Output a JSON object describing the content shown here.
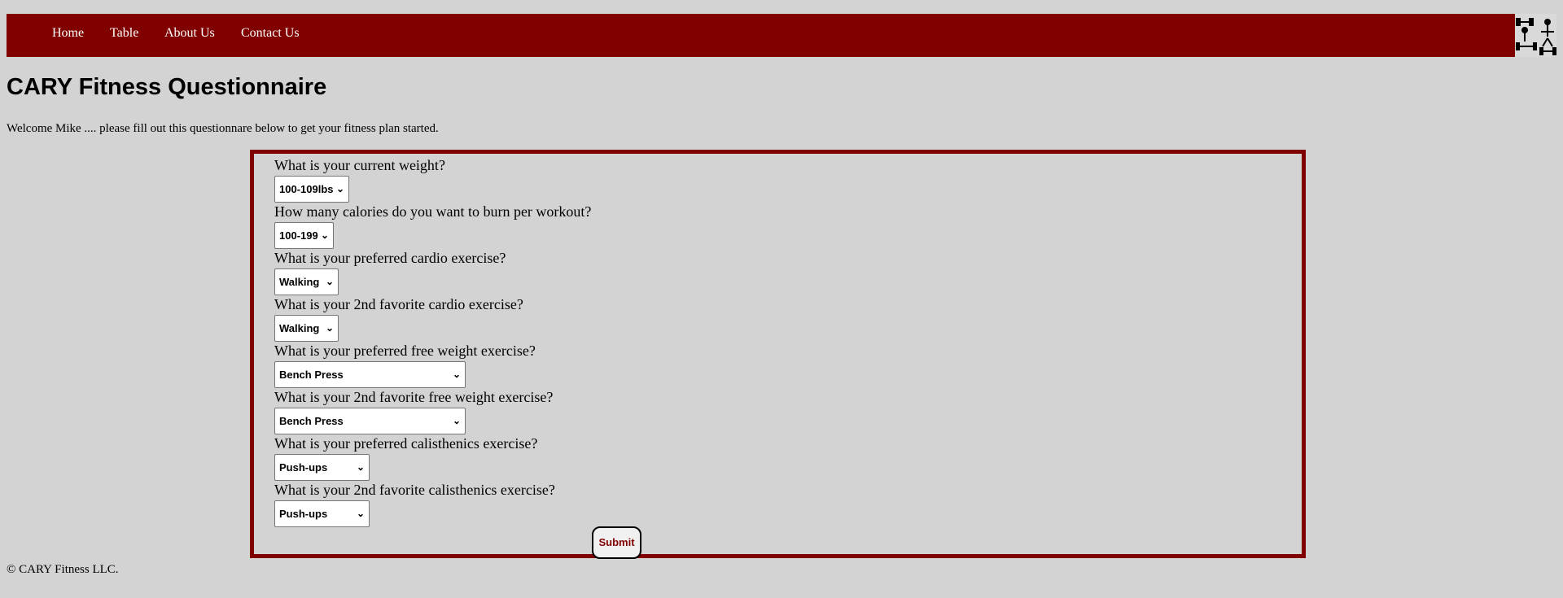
{
  "nav": {
    "items": [
      {
        "label": "Home"
      },
      {
        "label": "Table"
      },
      {
        "label": "About Us"
      },
      {
        "label": "Contact Us"
      }
    ],
    "logo_icon": "fitness-logo-icon",
    "background_color": "#800000"
  },
  "page": {
    "title": "CARY Fitness Questionnaire",
    "welcome": "Welcome Mike .... please fill out this questionnare below to get your fitness plan started."
  },
  "form": {
    "questions": [
      {
        "label": "What is your current weight?",
        "value": "100-109lbs"
      },
      {
        "label": "How many calories do you want to burn per workout?",
        "value": "100-199"
      },
      {
        "label": "What is your preferred cardio exercise?",
        "value": "Walking"
      },
      {
        "label": "What is your 2nd favorite cardio exercise?",
        "value": "Walking"
      },
      {
        "label": "What is your preferred free weight exercise?",
        "value": "Bench Press"
      },
      {
        "label": "What is your 2nd favorite free weight exercise?",
        "value": "Bench Press"
      },
      {
        "label": "What is your preferred calisthenics exercise?",
        "value": "Push-ups"
      },
      {
        "label": "What is your 2nd favorite calisthenics exercise?",
        "value": "Push-ups"
      }
    ],
    "submit_label": "Submit",
    "border_color": "#800000"
  },
  "footer": {
    "text": "© CARY Fitness LLC."
  }
}
